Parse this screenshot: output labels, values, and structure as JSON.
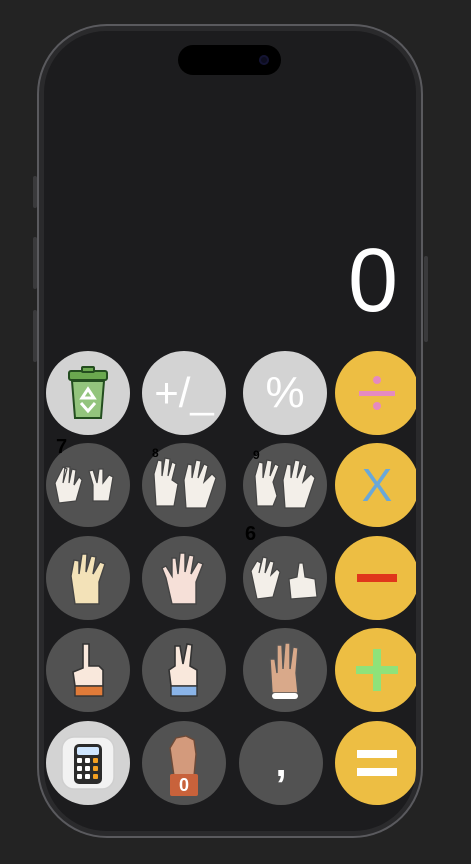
{
  "display": {
    "value": "0"
  },
  "keys": {
    "clear": {
      "icon": "recycle-bin-icon"
    },
    "plusminus": {
      "label": "+/_"
    },
    "percent": {
      "label": "%"
    },
    "divide": {
      "label": "÷",
      "icon": "divide-icon"
    },
    "seven": {
      "corner": "7",
      "icon": "seven-hands-icon"
    },
    "eight": {
      "corner": "8",
      "icon": "eight-hands-icon"
    },
    "nine": {
      "corner": "9",
      "icon": "nine-hands-icon"
    },
    "multiply": {
      "label": "X"
    },
    "four": {
      "icon": "four-fingers-hand-icon"
    },
    "five": {
      "icon": "open-palm-hand-icon"
    },
    "six": {
      "corner": "6",
      "icon": "six-hands-icon"
    },
    "minus": {
      "icon": "minus-icon"
    },
    "one": {
      "icon": "one-finger-hand-icon"
    },
    "two": {
      "icon": "two-fingers-hand-icon"
    },
    "three": {
      "icon": "three-fingers-hand-icon"
    },
    "plus": {
      "icon": "plus-icon"
    },
    "calculator": {
      "icon": "calculator-icon"
    },
    "zero": {
      "label": "0",
      "icon": "fist-zero-hand-icon"
    },
    "comma": {
      "label": ","
    },
    "equals": {
      "icon": "equals-icon"
    }
  },
  "colors": {
    "light_key": "#d3d3d3",
    "dark_key": "#525252",
    "operator_key": "#edbe43",
    "multiply_text": "#6aa8d8",
    "minus_bar": "#e0361b",
    "plus_sign": "#8fe27a",
    "divide_sign": "#e58ac0",
    "background": "#1c1c1e"
  }
}
